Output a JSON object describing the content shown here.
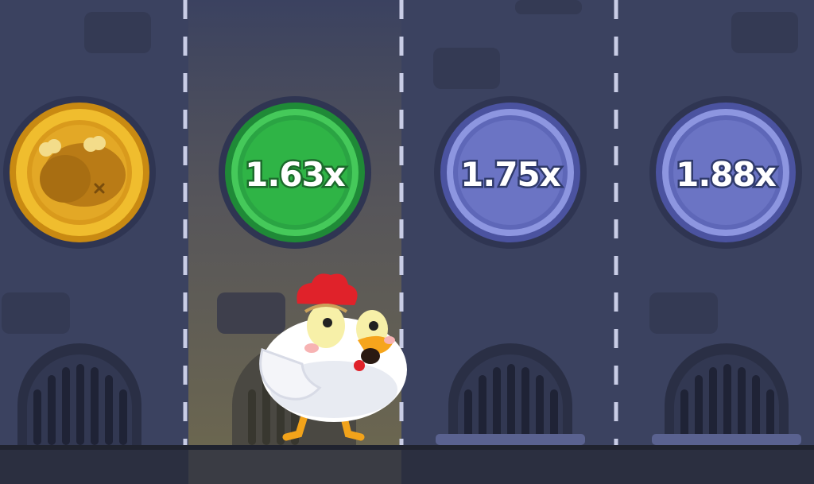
{
  "lanes": [
    {
      "state": "crashed",
      "coin": "chicken-drumstick-coin",
      "color": "#e9b12a"
    },
    {
      "state": "current",
      "multiplier": "1.63x",
      "color": "#2fb446"
    },
    {
      "state": "upcoming",
      "multiplier": "1.75x",
      "color": "#6b74c4"
    },
    {
      "state": "upcoming",
      "multiplier": "1.88x",
      "color": "#6b74c4"
    }
  ],
  "colors": {
    "background": "#3b4260",
    "lane_highlight": "#5a5850",
    "lane_divider": "#c9cde6",
    "floor": "#232633",
    "coin_gold": "#e9b12a",
    "coin_green": "#2fb446",
    "coin_blue": "#6b74c4"
  },
  "icons": [
    "roast-chicken-icon",
    "chicken-character",
    "sewer-grate-icon"
  ]
}
